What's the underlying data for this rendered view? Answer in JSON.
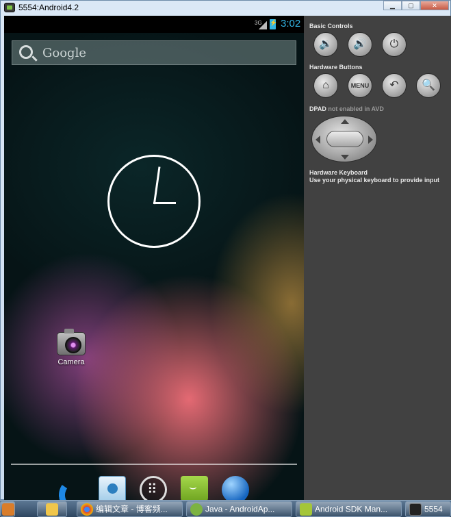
{
  "window": {
    "title": "5554:Android4.2",
    "controls": {
      "minimize": "▁",
      "maximize": "▢",
      "close": "✕"
    }
  },
  "statusbar": {
    "signal": "3G",
    "time": "3:02"
  },
  "home": {
    "search_placeholder": "Google",
    "apps": [
      {
        "label": "Camera"
      }
    ]
  },
  "panel": {
    "basic_controls_label": "Basic Controls",
    "hardware_buttons_label": "Hardware Buttons",
    "menu_label": "MENU",
    "dpad_label": "DPAD",
    "dpad_note": "not enabled in AVD",
    "keyboard_label": "Hardware Keyboard",
    "keyboard_note": "Use your physical keyboard to provide input"
  },
  "icons": {
    "volume_down": "🔉",
    "volume_up": "🔊",
    "power": "⏻",
    "home": "⌂",
    "back": "↶",
    "search": "🔍"
  },
  "taskbar": {
    "items": [
      {
        "label": "编辑文章 - 博客频..."
      },
      {
        "label": "Java - AndroidAp..."
      },
      {
        "label": "Android SDK Man..."
      },
      {
        "label": "5554"
      }
    ]
  },
  "colors": {
    "accent": "#33b5e5",
    "panel_bg": "#414141"
  }
}
